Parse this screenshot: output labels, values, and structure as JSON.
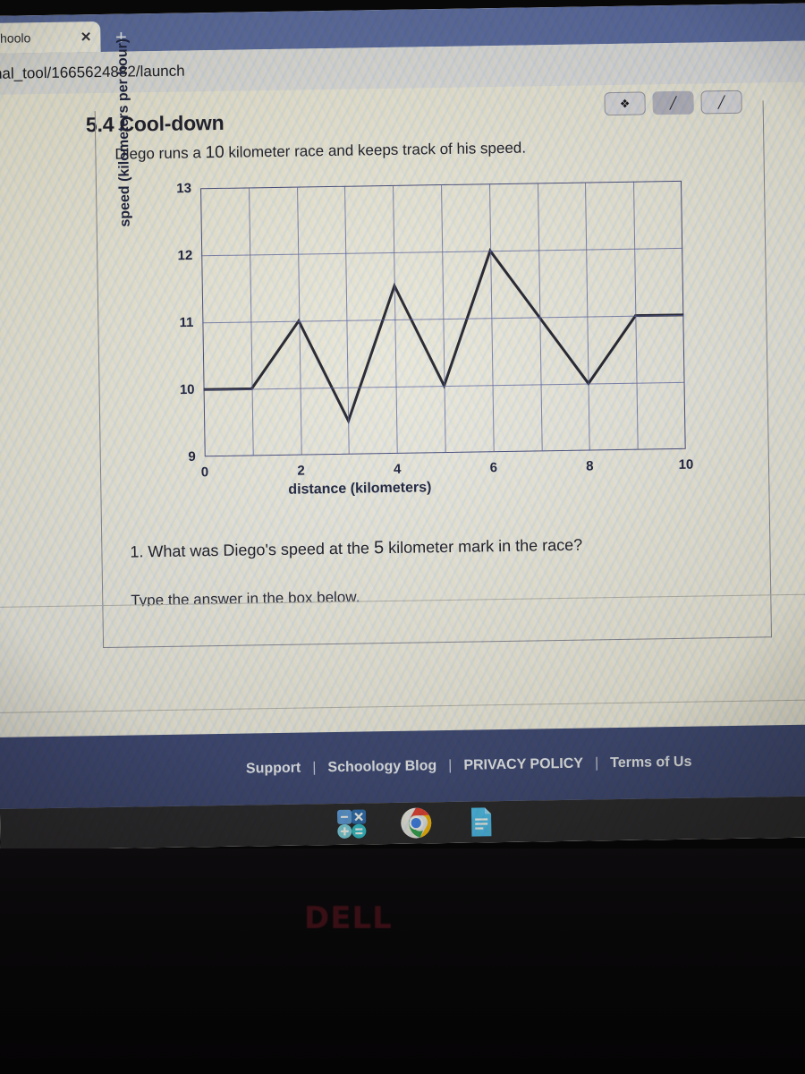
{
  "browser": {
    "tab_title": "wn | Schoolo",
    "tab_close_glyph": "✕",
    "newtab_glyph": "+",
    "url": "nal_tool/1665624882/launch"
  },
  "activity": {
    "title": "5.4 Cool-down",
    "prompt_prefix": "Diego runs a",
    "prompt_number": "10",
    "prompt_suffix": "kilometer race and keeps track of his speed.",
    "question_prefix": "1. What was Diego's speed at the",
    "question_number": "5",
    "question_suffix": "kilometer mark in the race?",
    "subprompt": "Type the answer in the box below."
  },
  "tools": [
    {
      "name": "select-tool",
      "glyph": "❖",
      "active": false
    },
    {
      "name": "pen-tool",
      "glyph": "╱",
      "active": true
    },
    {
      "name": "highlighter-tool",
      "glyph": "╱",
      "active": false
    }
  ],
  "chart_data": {
    "type": "line",
    "title": "",
    "xlabel": "distance (kilometers)",
    "ylabel": "speed (kilometers per hour)",
    "xlim": [
      0,
      10
    ],
    "ylim": [
      9,
      13
    ],
    "xticks": [
      "0",
      "2",
      "4",
      "6",
      "8",
      "10"
    ],
    "xtick_values": [
      0,
      2,
      4,
      6,
      8,
      10
    ],
    "yticks": [
      "9",
      "10",
      "11",
      "12",
      "13"
    ],
    "ytick_values": [
      9,
      10,
      11,
      12,
      13
    ],
    "x_minor_step": 1,
    "y_minor_step": 1,
    "grid": true,
    "legend": "none",
    "line_color": "#23232f",
    "grid_color": "#5b61a0",
    "x": [
      0,
      1,
      2,
      3,
      4,
      5,
      6,
      7,
      8,
      9,
      10
    ],
    "values": [
      10,
      10,
      11,
      9.5,
      11.5,
      10,
      12,
      11,
      10,
      11,
      11
    ],
    "series": [
      {
        "name": "speed",
        "values": [
          10,
          10,
          11,
          9.5,
          11.5,
          10,
          12,
          11,
          10,
          11,
          11
        ]
      }
    ]
  },
  "footer": {
    "links": [
      "Support",
      "Schoology Blog",
      "PRIVACY POLICY",
      "Terms of Us"
    ],
    "separator": "|"
  },
  "taskbar": {
    "items": [
      {
        "name": "calculator-icon",
        "label": "Calculator"
      },
      {
        "name": "chrome-icon",
        "label": "Google Chrome"
      },
      {
        "name": "google-docs-icon",
        "label": "Google Docs"
      }
    ]
  },
  "device": {
    "brand": "DELL"
  },
  "colors": {
    "tabstrip": "#5d6ea8",
    "footer": "#3f4a77",
    "grid": "#5b61a0",
    "line": "#23232f",
    "page": "#efece2"
  }
}
